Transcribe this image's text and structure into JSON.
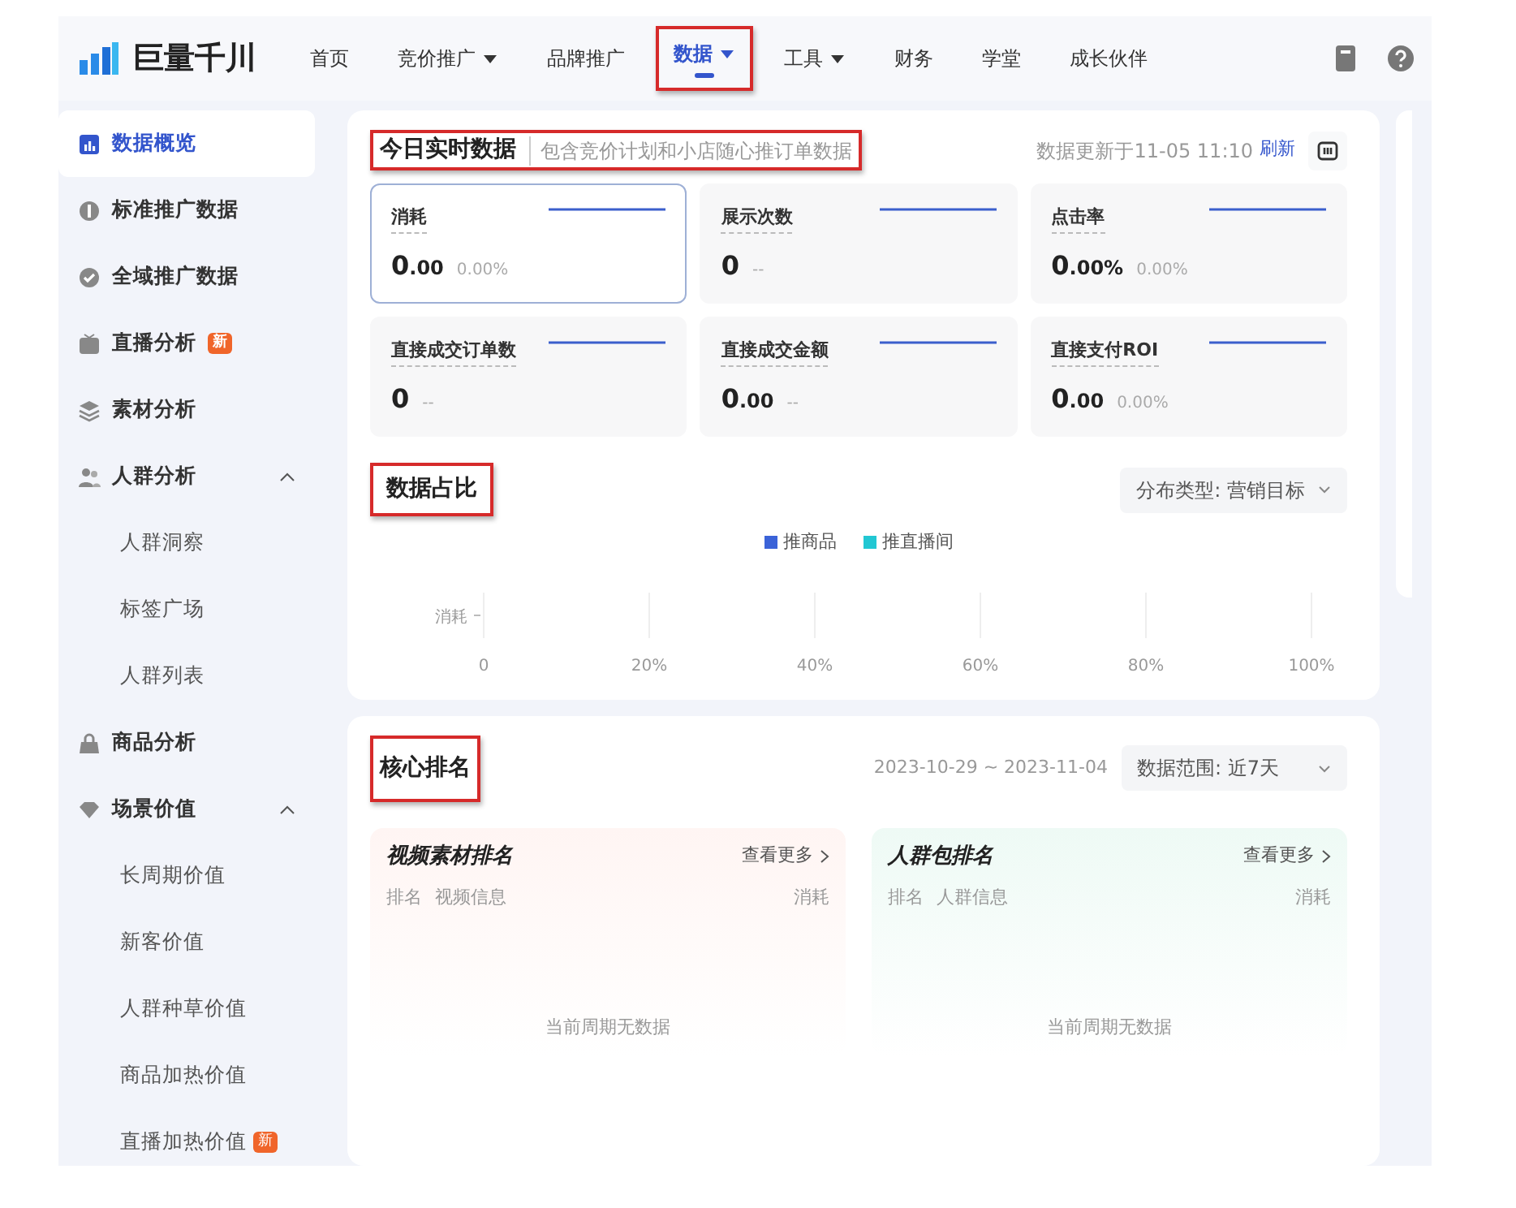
{
  "nav": {
    "logo": "巨量千川",
    "items": [
      {
        "label": "首页",
        "dropdown": false,
        "selected": false,
        "highlighted": false
      },
      {
        "label": "竞价推广",
        "dropdown": true,
        "selected": false,
        "highlighted": false
      },
      {
        "label": "品牌推广",
        "dropdown": false,
        "selected": false,
        "highlighted": false
      },
      {
        "label": "数据",
        "dropdown": true,
        "selected": true,
        "highlighted": true
      },
      {
        "label": "工具",
        "dropdown": true,
        "selected": false,
        "highlighted": false
      },
      {
        "label": "财务",
        "dropdown": false,
        "selected": false,
        "highlighted": false
      },
      {
        "label": "学堂",
        "dropdown": false,
        "selected": false,
        "highlighted": false
      },
      {
        "label": "成长伙伴",
        "dropdown": false,
        "selected": false,
        "highlighted": false
      }
    ]
  },
  "sidebar": {
    "items": [
      {
        "label": "数据概览",
        "selected": true
      },
      {
        "label": "标准推广数据",
        "selected": false
      },
      {
        "label": "全域推广数据",
        "selected": false
      },
      {
        "label": "直播分析",
        "selected": false,
        "badge": "新"
      },
      {
        "label": "素材分析",
        "selected": false
      },
      {
        "label": "人群分析",
        "selected": false,
        "expanded": true,
        "children": [
          {
            "label": "人群洞察",
            "selected": false
          },
          {
            "label": "标签广场",
            "selected": false
          },
          {
            "label": "人群列表",
            "selected": false
          }
        ]
      },
      {
        "label": "商品分析",
        "selected": false
      },
      {
        "label": "场景价值",
        "selected": false,
        "expanded": true,
        "children": [
          {
            "label": "长周期价值",
            "selected": false
          },
          {
            "label": "新客价值",
            "selected": false
          },
          {
            "label": "人群种草价值",
            "selected": false
          },
          {
            "label": "商品加热价值",
            "selected": false
          },
          {
            "label": "直播加热价值",
            "selected": false,
            "badge": "新"
          }
        ]
      }
    ]
  },
  "realtime": {
    "title": "今日实时数据",
    "subtitle": "包含竞价计划和小店随心推订单数据",
    "highlighted": true,
    "updated": "数据更新于11-05 11:10",
    "refresh": "刷新",
    "metrics": [
      {
        "label": "消耗",
        "value": "0",
        "decimals": ".00",
        "change": "0.00%",
        "selected": true
      },
      {
        "label": "展示次数",
        "value": "0",
        "change": "--",
        "selected": false
      },
      {
        "label": "点击率",
        "value": "0",
        "decimals": ".00%",
        "change": "0.00%",
        "selected": false
      },
      {
        "label": "直接成交订单数",
        "value": "0",
        "change": "--",
        "selected": false
      },
      {
        "label": "直接成交金额",
        "value": "0",
        "decimals": ".00",
        "change": "--",
        "selected": false
      },
      {
        "label": "直接支付ROI",
        "value": "0",
        "decimals": ".00",
        "change": "0.00%",
        "selected": false
      }
    ]
  },
  "share": {
    "title": "数据占比",
    "highlighted": true,
    "filter": "分布类型: 营销目标",
    "chart_data": {
      "type": "bar",
      "orientation": "horizontal",
      "categories": [
        "消耗"
      ],
      "series": [
        {
          "name": "推商品",
          "color": "#3b63d8",
          "values": [
            null
          ]
        },
        {
          "name": "推直播间",
          "color": "#22c7d3",
          "values": [
            null
          ]
        }
      ],
      "xlim": [
        0,
        1
      ],
      "xticks": [
        {
          "value": 0,
          "label": "0"
        },
        {
          "value": 0.2,
          "label": "20%"
        },
        {
          "value": 0.4,
          "label": "40%"
        },
        {
          "value": 0.6,
          "label": "60%"
        },
        {
          "value": 0.8,
          "label": "80%"
        },
        {
          "value": 1,
          "label": "100%"
        }
      ]
    }
  },
  "ranking": {
    "title": "核心排名",
    "highlighted": true,
    "date_range": "2023-10-29 ~ 2023-11-04",
    "filter": "数据范围: 近7天",
    "panels": [
      {
        "title": "视频素材排名",
        "more": "查看更多",
        "columns": [
          "排名",
          "视频信息",
          "消耗"
        ],
        "empty": "当前周期无数据"
      },
      {
        "title": "人群包排名",
        "more": "查看更多",
        "columns": [
          "排名",
          "人群信息",
          "消耗"
        ],
        "empty": "当前周期无数据"
      }
    ]
  }
}
